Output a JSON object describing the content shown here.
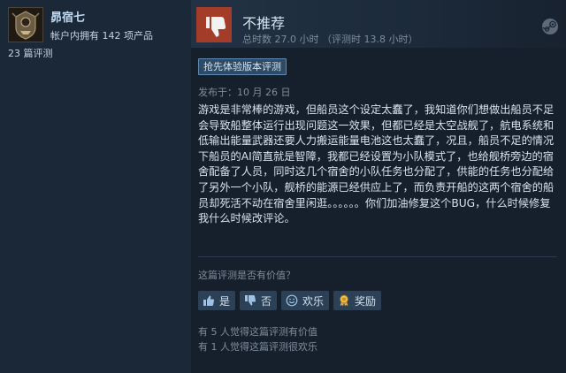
{
  "user": {
    "name": "昴宿七",
    "owned_text": "帐户内拥有 142 项产品",
    "reviews_text": "23 篇评测"
  },
  "review": {
    "verdict": "不推荐",
    "hours": "总时数 27.0 小时  （评测时 13.8 小时）",
    "badge": "抢先体验版本评测",
    "posted": "发布于：10 月 26 日",
    "text": "游戏是非常棒的游戏，但船员这个设定太蠢了，我知道你们想做出船员不足会导致船整体运行出现问题这一效果，但都已经是太空战舰了，航电系统和低输出能量武器还要人力搬运能量电池这也太蠢了，况且，船员不足的情况下船员的AI简直就是智障，我都已经设置为小队模式了，也给舰桥旁边的宿舍配备了人员，同时这几个宿舍的小队任务也分配了，供能的任务也分配给了另外一个小队，舰桥的能源已经供应上了，而负责开船的这两个宿舍的船员却死活不动在宿舍里闲逛。。。。。。你们加油修复这个BUG，什么时候修复我什么时候改评论。"
  },
  "feedback": {
    "question": "这篇评测是否有价值？",
    "buttons": {
      "yes": "是",
      "no": "否",
      "funny": "欢乐",
      "award": "奖励"
    },
    "stat_helpful": "有 5 人觉得这篇评测有价值",
    "stat_funny": "有 1 人觉得这篇评测很欢乐"
  },
  "icons": {
    "avatar": "avatar-emblem-icon",
    "verdict": "thumbs-down-icon",
    "platform": "steam-logo-icon",
    "yes": "thumbs-up-icon",
    "no": "thumbs-down-icon",
    "funny": "smile-icon",
    "award": "award-icon"
  },
  "colors": {
    "background": "#1b2838",
    "review_panel": "#16202d",
    "not_recommended": "#a43c2a",
    "button": "#2c4156",
    "badge_border": "#5d8ab4"
  }
}
